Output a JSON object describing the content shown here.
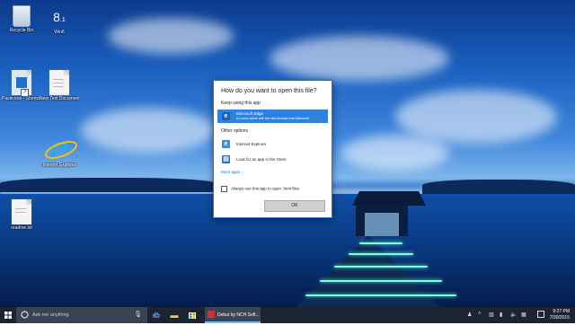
{
  "desktop": {
    "icons": [
      {
        "label": "Recycle Bin"
      },
      {
        "label": "Win8"
      },
      {
        "label": "Paste.exe - Shortcut"
      },
      {
        "label": "New Text Document.txt"
      },
      {
        "label": "Internet Explorer"
      },
      {
        "label": "readme.txt"
      }
    ]
  },
  "dialog": {
    "title": "How do you want to open this file?",
    "keep_label": "Keep using this app",
    "primary_app": {
      "name": "Microsoft Edge",
      "desc": "Do more online with the new browser from Microsoft.",
      "icon": "edge-icon"
    },
    "other_label": "Other options",
    "other_apps": [
      {
        "name": "Internet Explorer",
        "icon": "ie-icon"
      },
      {
        "name": "Look for an app in the Store",
        "icon": "store-icon"
      }
    ],
    "more_apps": "More apps ↓",
    "always_label": "Always use this app to open .html files",
    "always_checked": false,
    "ok_label": "OK"
  },
  "taskbar": {
    "search_placeholder": "Ask me anything",
    "open_app": "Debut by NCH Soft...",
    "time": "9:27 PM",
    "date": "7/30/2015"
  },
  "colors": {
    "accent": "#2d82dc",
    "taskbar": "#1c2433",
    "dialog_border": "#2a6fd6"
  }
}
